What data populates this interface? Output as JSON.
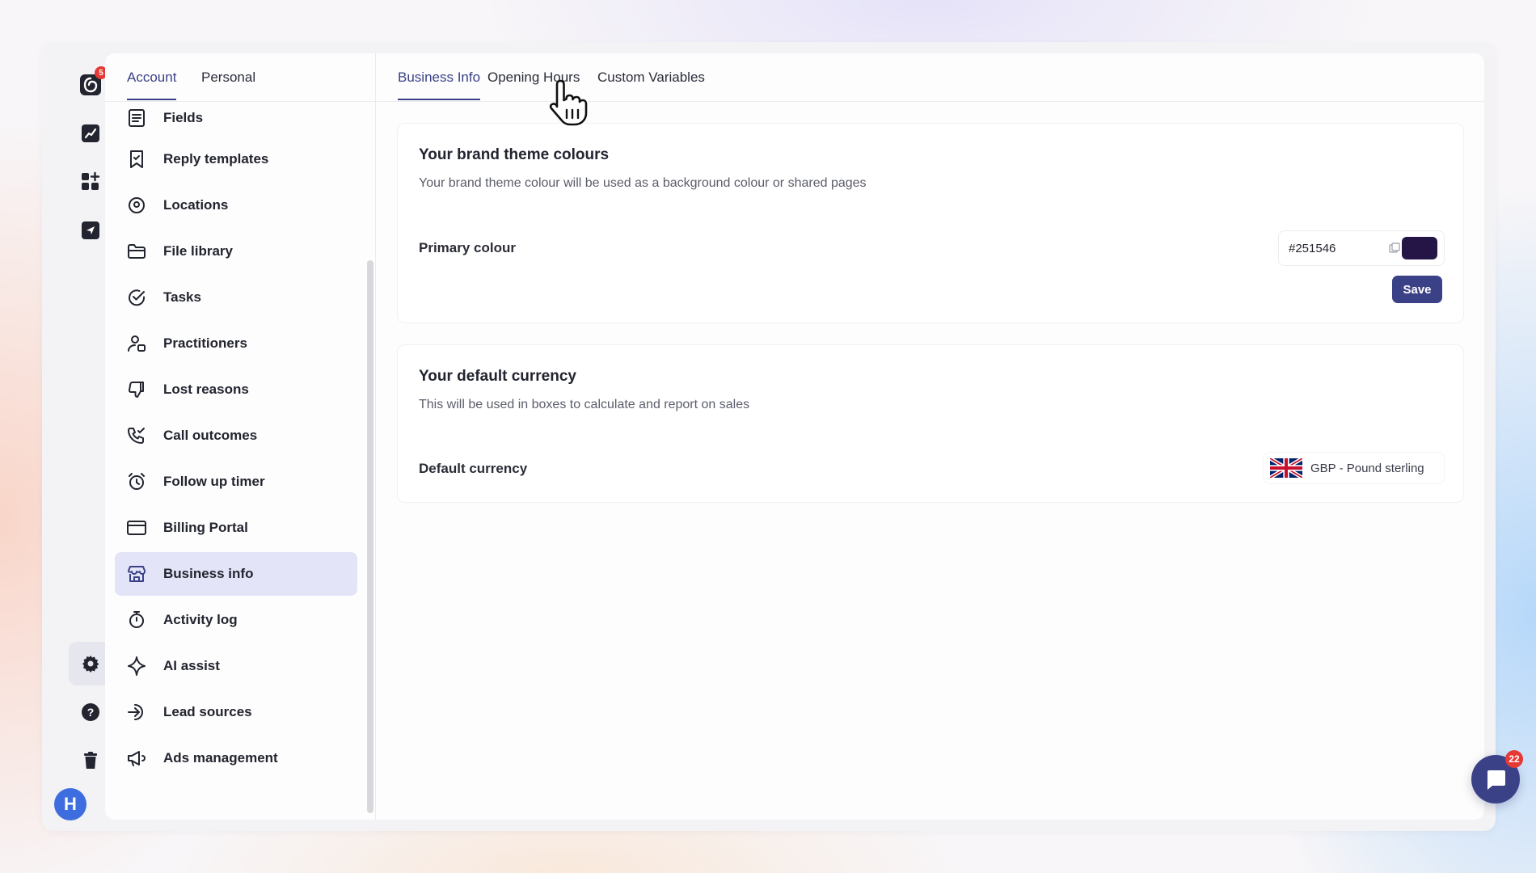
{
  "rail": {
    "notification_count": "5",
    "avatar_initial": "H"
  },
  "settings": {
    "tabs": [
      {
        "label": "Account",
        "active": true
      },
      {
        "label": "Personal",
        "active": false
      }
    ],
    "nav_items": [
      {
        "label": "Fields",
        "icon": "list-icon"
      },
      {
        "label": "Reply templates",
        "icon": "bookmark-icon"
      },
      {
        "label": "Locations",
        "icon": "location-pin-icon"
      },
      {
        "label": "File library",
        "icon": "folder-icon"
      },
      {
        "label": "Tasks",
        "icon": "check-circle-icon"
      },
      {
        "label": "Practitioners",
        "icon": "user-icon"
      },
      {
        "label": "Lost reasons",
        "icon": "thumbs-down-icon"
      },
      {
        "label": "Call outcomes",
        "icon": "phone-check-icon"
      },
      {
        "label": "Follow up timer",
        "icon": "alarm-clock-icon"
      },
      {
        "label": "Billing Portal",
        "icon": "credit-card-icon"
      },
      {
        "label": "Business info",
        "icon": "store-icon",
        "active": true
      },
      {
        "label": "Activity log",
        "icon": "stopwatch-icon"
      },
      {
        "label": "AI assist",
        "icon": "sparkle-icon"
      },
      {
        "label": "Lead sources",
        "icon": "sign-in-arrow-icon"
      },
      {
        "label": "Ads management",
        "icon": "megaphone-icon"
      }
    ]
  },
  "content": {
    "tabs": [
      {
        "label": "Business Info",
        "active": true
      },
      {
        "label": "Opening Hours",
        "active": false
      },
      {
        "label": "Custom Variables",
        "active": false
      }
    ],
    "brand": {
      "title": "Your brand theme colours",
      "description": "Your brand theme colour will be used as a background colour or shared pages",
      "primary_label": "Primary colour",
      "primary_value": "#251546",
      "swatch_color": "#251546",
      "save_label": "Save"
    },
    "currency": {
      "title": "Your default currency",
      "description": "This will be used in boxes to calculate and report on sales",
      "label": "Default currency",
      "value": "GBP  -  Pound sterling",
      "flag_icon": "uk-flag-icon"
    }
  },
  "chat": {
    "unread_count": "22"
  },
  "colors": {
    "accent": "#3b4187",
    "active_nav_bg": "#e4e4f8",
    "badge": "#e53935",
    "avatar": "#3d6dde"
  }
}
